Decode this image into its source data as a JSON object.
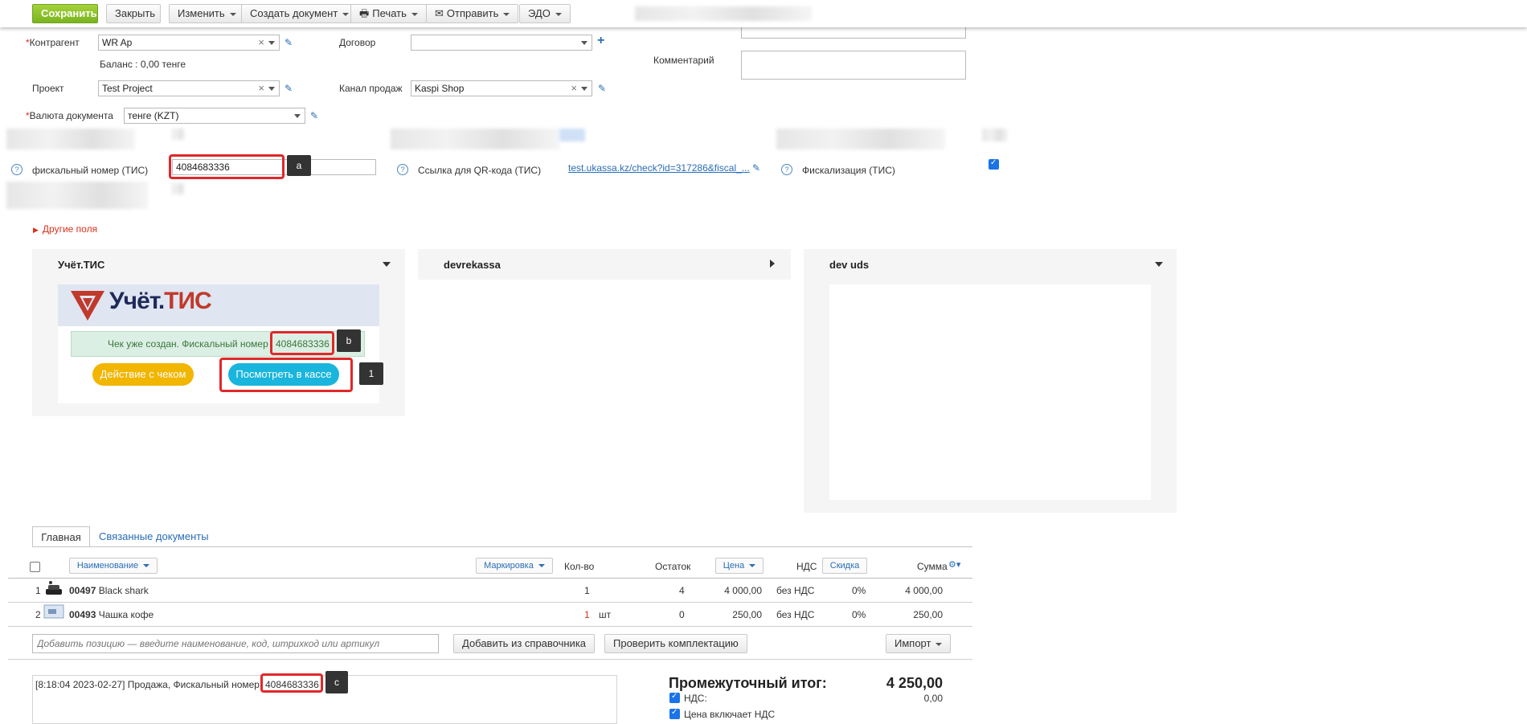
{
  "toolbar": {
    "save": "Сохранить",
    "close": "Закрыть",
    "edit": "Изменить",
    "create_doc": "Создать документ",
    "print": "Печать",
    "send": "Отправить",
    "edo": "ЭДО"
  },
  "form": {
    "counterparty_label": "Контрагент",
    "counterparty_value": "WR Ap",
    "balance": "Баланс : 0,00 тенге",
    "contract_label": "Договор",
    "contract_value": "",
    "comment_label": "Комментарий",
    "project_label": "Проект",
    "project_value": "Test Project",
    "sales_channel_label": "Канал продаж",
    "sales_channel_value": "Kaspi Shop",
    "currency_label": "Валюта документа",
    "currency_value": "тенге (KZT)",
    "fiscal_label": "фискальный номер (ТИС)",
    "fiscal_value": "4084683336",
    "qr_label": "Ссылка для QR-кода (ТИС)",
    "qr_link": "test.ukassa.kz/check?id=317286&fiscal_...",
    "fiscalization_label": "Фискализация (ТИС)",
    "fiscalization_checked": true,
    "other_fields": "Другие поля"
  },
  "annotations": {
    "a": "a",
    "b": "b",
    "one": "1",
    "c": "c"
  },
  "widgets": {
    "tis": {
      "title": "Учёт.ТИС",
      "logo_text": "Учёт.",
      "logo_accent": "ТИС",
      "message": "Чек уже создан. Фискальный номер",
      "fiscal": "4084683336",
      "action_btn": "Действие с чеком",
      "view_btn": "Посмотреть в кассе"
    },
    "devrekassa": {
      "title": "devrekassa"
    },
    "devuds": {
      "title": "dev uds"
    }
  },
  "tabs": {
    "main": "Главная",
    "related": "Связанные документы"
  },
  "table": {
    "headers": {
      "name": "Наименование",
      "marking": "Маркировка",
      "qty": "Кол-во",
      "stock": "Остаток",
      "price": "Цена",
      "vat": "НДС",
      "discount": "Скидка",
      "sum": "Сумма"
    },
    "rows": [
      {
        "n": "1",
        "code": "00497",
        "name": "Black shark",
        "qty": "1",
        "unit": "",
        "stock": "4",
        "price": "4 000,00",
        "vat": "без НДС",
        "discount": "0%",
        "sum": "4 000,00"
      },
      {
        "n": "2",
        "code": "00493",
        "name": "Чашка кофе",
        "qty": "1",
        "unit": "шт",
        "stock": "0",
        "price": "250,00",
        "vat": "без НДС",
        "discount": "0%",
        "sum": "250,00"
      }
    ],
    "add_placeholder": "Добавить позицию — введите наименование, код, штрихкод или артикул",
    "add_from_ref": "Добавить из справочника",
    "check_kit": "Проверить комплектацию",
    "import": "Импорт"
  },
  "log": {
    "text": "[8:18:04 2023-02-27] Продажа, Фискальный номер",
    "fiscal": "4084683336"
  },
  "totals": {
    "subtotal_label": "Промежуточный итог:",
    "subtotal_value": "4 250,00",
    "vat_label": "НДС:",
    "vat_value": "0,00",
    "price_incl_vat": "Цена включает НДС"
  }
}
